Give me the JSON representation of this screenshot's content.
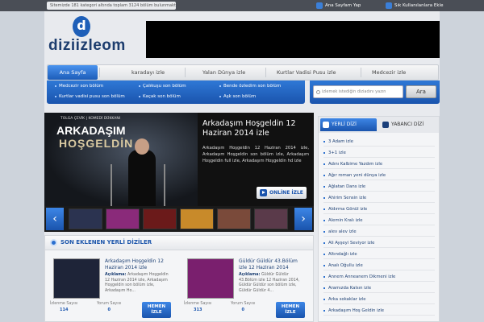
{
  "topbar": {
    "message": "Sitemizde 181 kategori altında toplam 3124 bölüm bulunmaktadır.",
    "homepage_link": "Ana Sayfam Yap",
    "favorites_link": "Sık Kullanılanlara Ekle"
  },
  "logo": {
    "letter": "d",
    "text": "diziizleom"
  },
  "nav": {
    "items": [
      "Ana Sayfa",
      "karadayı izle",
      "Yalan Dünya izle",
      "Kurtlar Vadisi Pusu izle",
      "Medcezir izle"
    ]
  },
  "subnav": {
    "links": [
      "Medcezir son bölüm",
      "Çalıkuşu son bölüm",
      "Bende özledim son bölüm",
      "Kurtlar vadisi pusu son bölüm",
      "Kaçak son bölüm",
      "Aşk son bölüm"
    ]
  },
  "search": {
    "placeholder": "izlemek istediğin diziadını yazın",
    "button": "Ara"
  },
  "slider": {
    "image_top": "TOLGA ÇEVİK   |   KOMEDİ DÜKKANI",
    "image_title1": "ARKADAŞIM",
    "image_title2": "HOŞGELDİN",
    "title": "Arkadaşım Hoşgeldin 12 Haziran 2014 izle",
    "description": "Arkadaşım Hoşgeldin 12 Haziran 2014 izle, Arkadaşım Hoşgeldin son bölüm izle, Arkadaşım Hoşgeldin full izle, Arkadaşım Hoşgeldin hd izle",
    "online_button": "ONLİNE İZLE",
    "prev": "‹",
    "next": "›",
    "thumb_colors": [
      "#2b3350",
      "#8a2a7a",
      "#6b1a1a",
      "#c88a2a",
      "#7a4a3a",
      "#5a3a4a"
    ]
  },
  "recent": {
    "title": "SON EKLENEN YERLİ DİZİLER",
    "cards": [
      {
        "title": "Arkadaşım Hoşgeldin 12 Haziran 2014 izle",
        "desc_label": "Açıklama:",
        "description": "Arkadaşım Hoşgeldin 12 Haziran 2014 izle, Arkadaşım Hoşgeldin son bölüm izle, Arkadaşım Ho...",
        "views_label": "İzlenme Sayısı",
        "views": "114",
        "comments_label": "Yorum Sayısı",
        "comments": "0",
        "watch_button_1": "HEMEN",
        "watch_button_2": "İZLE",
        "img_color": "#1e2438"
      },
      {
        "title": "Güldür Güldür 43.Bölüm izle 12 Haziran 2014",
        "desc_label": "Açıklama:",
        "description": "Güldür Güldür 43.Bölüm izle 12 Haziran 2014, Güldür Güldür son bölüm izle, Güldür Güldür 4...",
        "views_label": "İzlenme Sayısı",
        "views": "313",
        "comments_label": "Yorum Sayısı",
        "comments": "0",
        "watch_button_1": "HEMEN",
        "watch_button_2": "İZLE",
        "img_color": "#7a1f6e"
      }
    ]
  },
  "sidebar": {
    "tab_local": "YERLİ DİZİ",
    "tab_foreign": "YABANCI DİZİ",
    "items": [
      "3 Adam izle",
      "3+1 izle",
      "Adını Kalbime Yazdım izle",
      "Ağır roman yeni dünya izle",
      "Ağlatan Dans izle",
      "Ahirim Sensin izle",
      "Aldırma Gönül izle",
      "Alemin Kralı izle",
      "alev alev izle",
      "Ali Ayşeyi Seviyor izle",
      "Altındağlı izle",
      "Analı Oğullu izle",
      "Annem Anneanem Dikmeni izle",
      "Aramızda Kalsın izle",
      "Arka sokaklar izle",
      "Arkadaşım Hoş Geldin izle"
    ]
  }
}
